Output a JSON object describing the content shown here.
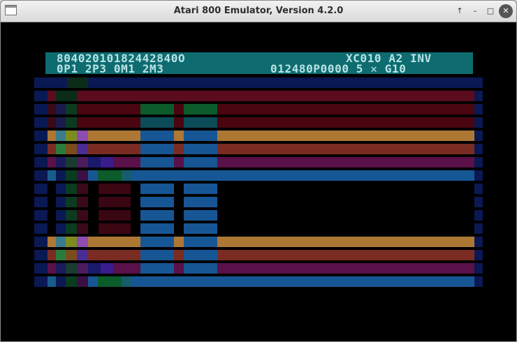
{
  "window": {
    "title": "Atari 800 Emulator, Version 4.2.0",
    "controls": [
      "up-arrow-icon",
      "minimize-icon",
      "maximize-icon",
      "close-icon"
    ]
  },
  "status_line": {
    "row1": {
      "left": "80402010182442840O",
      "right": "XC010 A2 INV"
    },
    "row2": {
      "left": "0P1 2P3 0M1 2M3",
      "right": "012480P0000 5 ✕ G10"
    }
  },
  "palette": {
    "background": "#000000",
    "status_bg": "#0e6c70",
    "status_text": "#b8e3e5",
    "navy": "#0a1854",
    "darkred": "#4a0510",
    "maroon": "#5a0c1e",
    "green": "#0b5c2a",
    "teal": "#0b4c58",
    "orange": "#ad7834",
    "rust": "#7a2c22",
    "magenta": "#5a1048",
    "blue": "#175694",
    "cyan_gray": "#3a7c8c",
    "olive": "#7c8c1e",
    "violet": "#8c4cb0",
    "purple": "#4a2c94"
  }
}
